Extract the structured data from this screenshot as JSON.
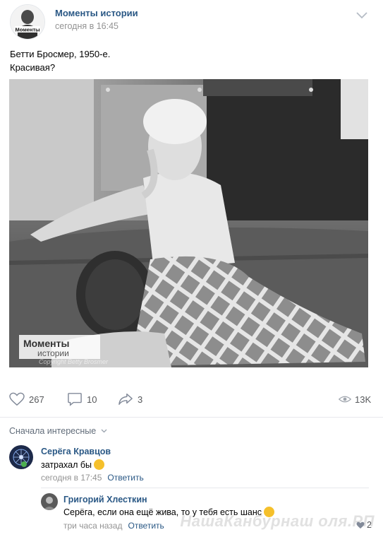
{
  "post": {
    "group_name": "Моменты истории",
    "time": "сегодня в 16:45",
    "text_line1": "Бетти Бросмер, 1950-е.",
    "text_line2": "Красивая?",
    "avatar_text": "Моменты"
  },
  "photo": {
    "logo_line1": "Моменты",
    "logo_line2": "истории",
    "copyright": "Copyright Betty Brosmer"
  },
  "actions": {
    "likes": "267",
    "comments": "10",
    "shares": "3",
    "views": "13K"
  },
  "comments_header": {
    "sort_label": "Сначала интересные"
  },
  "comments": [
    {
      "author": "Серёга Кравцов",
      "text": "затрахал бы",
      "time": "сегодня в 17:45",
      "reply_label": "Ответить"
    },
    {
      "author": "Григорий Хлесткин",
      "text": "Серёга, если она ещё жива, то у тебя есть шанс",
      "time": "три часа назад",
      "reply_label": "Ответить",
      "likes": "2"
    }
  ],
  "watermark": "НашаКанбурнаш оля.РП",
  "colors": {
    "link": "#2a5885",
    "meta": "#939393",
    "action": "#57595c"
  }
}
